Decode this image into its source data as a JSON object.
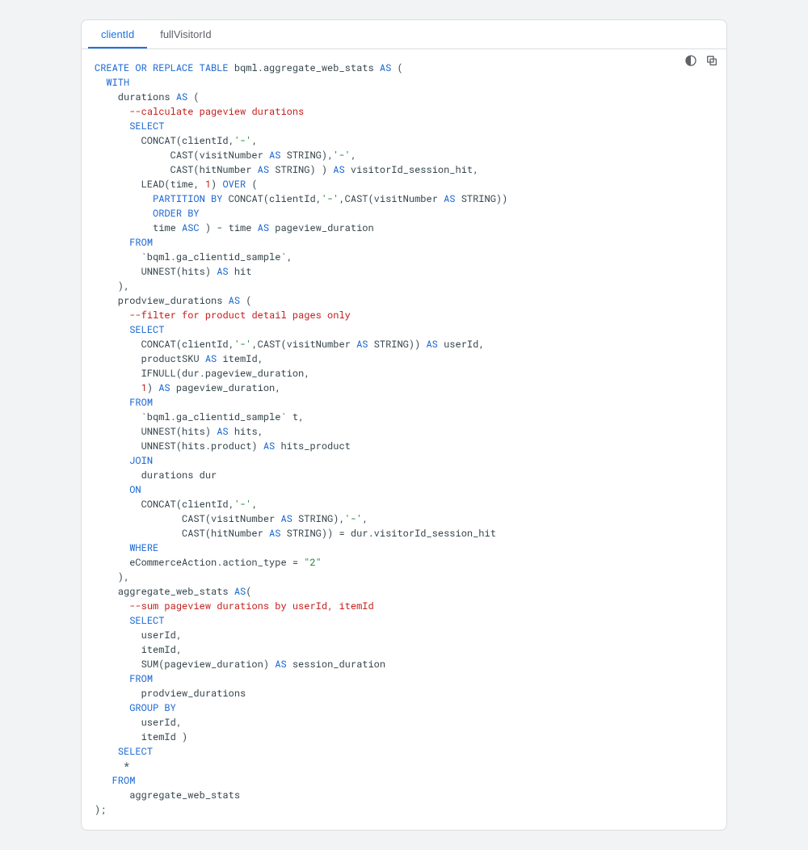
{
  "tabs": [
    {
      "label": "clientId",
      "active": true
    },
    {
      "label": "fullVisitorId",
      "active": false
    }
  ],
  "toolbar": {
    "themeToggle": "toggle-dark-mode",
    "copy": "copy-code"
  },
  "code": {
    "l01a": "CREATE OR REPLACE",
    "l01b": " TABLE",
    "l01c": " bqml.aggregate_web_stats ",
    "l01d": "AS",
    "l01e": " (",
    "l02a": "  ",
    "l02b": "WITH",
    "l03a": "    durations ",
    "l03b": "AS",
    "l03c": " (",
    "l04a": "      ",
    "l04b": "--calculate pageview durations",
    "l05a": "      ",
    "l05b": "SELECT",
    "l06a": "        CONCAT(clientId,",
    "l06b": "'-'",
    "l06c": ",",
    "l07a": "             CAST(visitNumber ",
    "l07b": "AS",
    "l07c": " STRING),",
    "l07d": "'-'",
    "l07e": ",",
    "l08a": "             CAST(hitNumber ",
    "l08b": "AS",
    "l08c": " STRING) ) ",
    "l08d": "AS",
    "l08e": " visitorId_session_hit,",
    "l09a": "        LEAD(time, ",
    "l09b": "1",
    "l09c": ") ",
    "l09d": "OVER",
    "l09e": " (",
    "l10a": "          ",
    "l10b": "PARTITION BY",
    "l10c": " CONCAT(clientId,",
    "l10d": "'-'",
    "l10e": ",CAST(visitNumber ",
    "l10f": "AS",
    "l10g": " STRING))",
    "l11a": "          ",
    "l11b": "ORDER BY",
    "l12a": "          time ",
    "l12b": "ASC",
    "l12c": " ) - time ",
    "l12d": "AS",
    "l12e": " pageview_duration",
    "l13a": "      ",
    "l13b": "FROM",
    "l14a": "        `bqml.ga_clientid_sample`,",
    "l15a": "        UNNEST(hits) ",
    "l15b": "AS",
    "l15c": " hit",
    "l16a": "    ),",
    "l17a": "    prodview_durations ",
    "l17b": "AS",
    "l17c": " (",
    "l18a": "      ",
    "l18b": "--filter for product detail pages only",
    "l19a": "      ",
    "l19b": "SELECT",
    "l20a": "        CONCAT(clientId,",
    "l20b": "'-'",
    "l20c": ",CAST(visitNumber ",
    "l20d": "AS",
    "l20e": " STRING)) ",
    "l20f": "AS",
    "l20g": " userId,",
    "l21a": "        productSKU ",
    "l21b": "AS",
    "l21c": " itemId,",
    "l22a": "        IFNULL(dur.pageview_duration,",
    "l23a": "        ",
    "l23b": "1",
    "l23c": ") ",
    "l23d": "AS",
    "l23e": " pageview_duration,",
    "l24a": "      ",
    "l24b": "FROM",
    "l25a": "        `bqml.ga_clientid_sample` t,",
    "l26a": "        UNNEST(hits) ",
    "l26b": "AS",
    "l26c": " hits,",
    "l27a": "        UNNEST(hits.product) ",
    "l27b": "AS",
    "l27c": " hits_product",
    "l28a": "      ",
    "l28b": "JOIN",
    "l29a": "        durations dur",
    "l30a": "      ",
    "l30b": "ON",
    "l31a": "        CONCAT(clientId,",
    "l31b": "'-'",
    "l31c": ",",
    "l32a": "               CAST(visitNumber ",
    "l32b": "AS",
    "l32c": " STRING),",
    "l32d": "'-'",
    "l32e": ",",
    "l33a": "               CAST(hitNumber ",
    "l33b": "AS",
    "l33c": " STRING)) = dur.visitorId_session_hit",
    "l34a": "      ",
    "l34b": "WHERE",
    "l35a": "      eCommerceAction.action_type = ",
    "l35b": "\"2\"",
    "l36a": "    ),",
    "l37a": "    aggregate_web_stats ",
    "l37b": "AS",
    "l37c": "(",
    "l38a": "      ",
    "l38b": "--sum pageview durations by userId, itemId",
    "l39a": "      ",
    "l39b": "SELECT",
    "l40a": "        userId,",
    "l41a": "        itemId,",
    "l42a": "        SUM(pageview_duration) ",
    "l42b": "AS",
    "l42c": " session_duration",
    "l43a": "      ",
    "l43b": "FROM",
    "l44a": "        prodview_durations",
    "l45a": "      ",
    "l45b": "GROUP BY",
    "l46a": "        userId,",
    "l47a": "        itemId )",
    "l48a": "    ",
    "l48b": "SELECT",
    "l49a": "     *",
    "l50a": "   ",
    "l50b": "FROM",
    "l51a": "      aggregate_web_stats",
    "l52a": ");"
  }
}
